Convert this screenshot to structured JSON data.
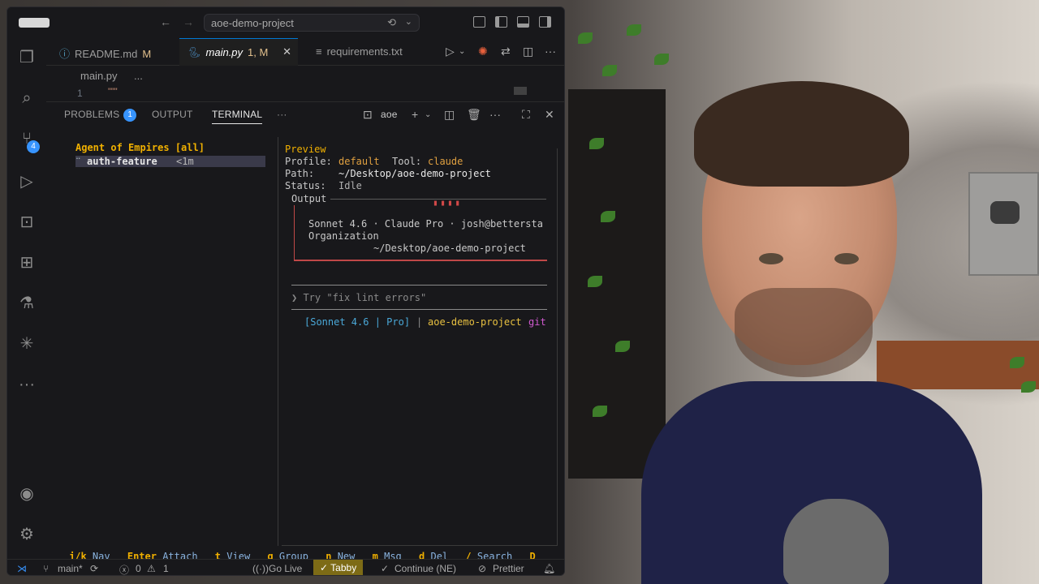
{
  "window": {
    "command_center": "aoe-demo-project"
  },
  "tabs": [
    {
      "label": "README.md",
      "status": "M"
    },
    {
      "label": "main.py",
      "status": "1, M"
    },
    {
      "label": "requirements.txt",
      "status": ""
    }
  ],
  "breadcrumb": {
    "file": "main.py",
    "more": "..."
  },
  "editor": {
    "line_number": "1",
    "code": "\"\"\""
  },
  "activity": {
    "source_control_badge": "4"
  },
  "panel": {
    "problems_label": "PROBLEMS",
    "problems_count": "1",
    "output_label": "OUTPUT",
    "terminal_label": "TERMINAL",
    "more": "···",
    "terminal_name": "aoe"
  },
  "terminal": {
    "title": "Agent of Empires [all]",
    "session": {
      "dots": "⠒",
      "name": "auth-feature",
      "age": "<1m"
    },
    "preview_label": "Preview",
    "profile_label": "Profile:",
    "profile_value": "default",
    "tool_label": "Tool:",
    "tool_value": "claude",
    "path_label": "Path:",
    "path_value": "~/Desktop/aoe-demo-project",
    "status_label": "Status:",
    "status_value": "Idle",
    "output_label": "Output",
    "claude_line1": "Sonnet 4.6 · Claude Pro · josh@bettersta",
    "claude_line2": "Organization",
    "claude_line3": "~/Desktop/aoe-demo-project",
    "prompt_hint": "❯ Try \"fix lint errors\"",
    "statusline_model": "[Sonnet 4.6 | Pro]",
    "statusline_sep": "|",
    "statusline_project": "aoe-demo-project",
    "statusline_git": "git",
    "footer": [
      {
        "key": "j/k",
        "desc": "Nav"
      },
      {
        "key": "Enter",
        "desc": "Attach"
      },
      {
        "key": "t",
        "desc": "View"
      },
      {
        "key": "g",
        "desc": "Group"
      },
      {
        "key": "n",
        "desc": "New"
      },
      {
        "key": "m",
        "desc": "Msg"
      },
      {
        "key": "d",
        "desc": "Del"
      },
      {
        "key": "/",
        "desc": "Search"
      },
      {
        "key": "D",
        "desc": ""
      }
    ]
  },
  "statusbar": {
    "branch": "main*",
    "errors": "0",
    "warnings": "1",
    "golive": "Go Live",
    "tabby": "Tabby",
    "continue": "Continue (NE)",
    "prettier": "Prettier"
  },
  "colors": {
    "accent": "#0078d4",
    "badge": "#3794ff",
    "tabby": "#7d6b16",
    "terminal_title": "#f0b000"
  }
}
